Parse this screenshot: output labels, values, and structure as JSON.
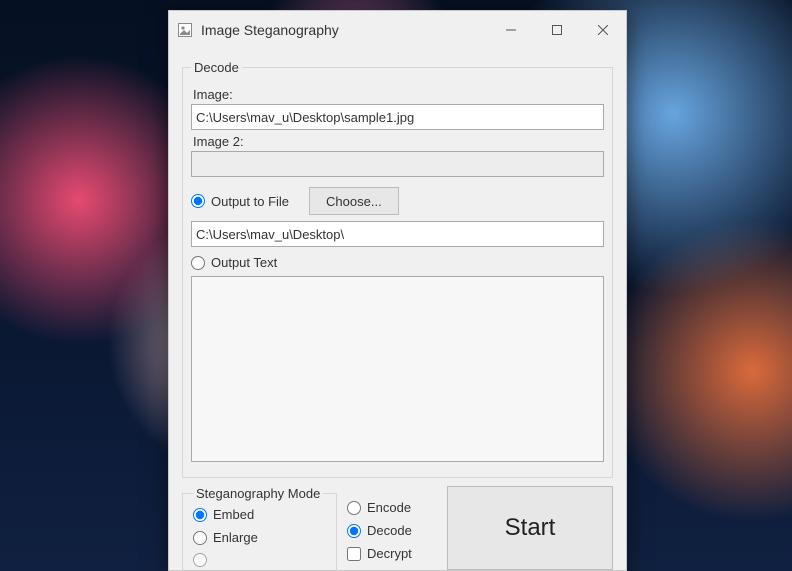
{
  "window": {
    "title": "Image Steganography"
  },
  "decode": {
    "legend": "Decode",
    "image_label": "Image:",
    "image_value": "C:\\Users\\mav_u\\Desktop\\sample1.jpg",
    "image2_label": "Image 2:",
    "image2_value": "",
    "output_to_file_label": "Output to File",
    "choose_label": "Choose...",
    "output_path_value": "C:\\Users\\mav_u\\Desktop\\",
    "output_text_label": "Output Text",
    "output_text_value": ""
  },
  "mode": {
    "legend": "Steganography Mode",
    "embed": "Embed",
    "enlarge": "Enlarge"
  },
  "right_opts": {
    "encode": "Encode",
    "decode": "Decode",
    "decrypt": "Decrypt"
  },
  "start_label": "Start"
}
